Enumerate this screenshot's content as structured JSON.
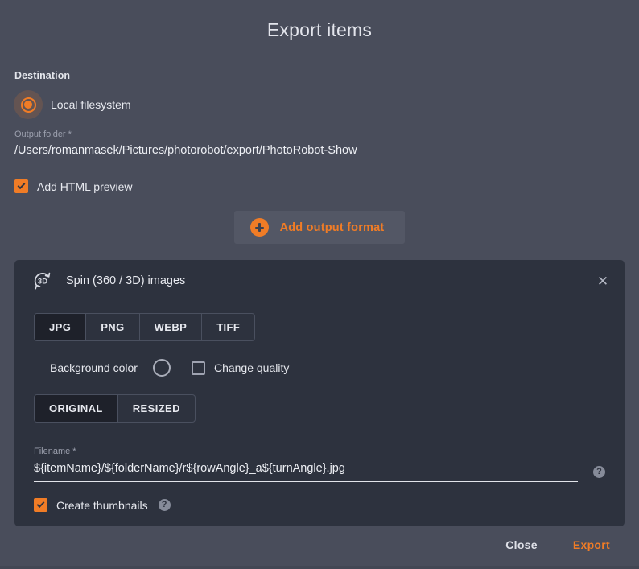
{
  "dialog": {
    "title": "Export items"
  },
  "destination": {
    "section_label": "Destination",
    "radio_label": "Local filesystem",
    "radio_selected": true,
    "output_folder": {
      "label": "Output folder *",
      "value": "/Users/romanmasek/Pictures/photorobot/export/PhotoRobot-Show"
    },
    "html_preview": {
      "label": "Add HTML preview",
      "checked": true
    }
  },
  "add_output_format": {
    "label": "Add output format",
    "icon": "plus-circle-icon"
  },
  "format_card": {
    "icon": "spin-3d-icon",
    "icon_text": "3D",
    "title": "Spin (360 / 3D) images",
    "close_icon": "close-icon",
    "file_type_tabs": [
      {
        "label": "JPG",
        "active": true
      },
      {
        "label": "PNG",
        "active": false
      },
      {
        "label": "WEBP",
        "active": false
      },
      {
        "label": "TIFF",
        "active": false
      }
    ],
    "background_color": {
      "label": "Background color",
      "swatch_icon": "color-swatch-icon"
    },
    "change_quality": {
      "label": "Change quality",
      "checked": false
    },
    "size_tabs": [
      {
        "label": "ORIGINAL",
        "active": true
      },
      {
        "label": "RESIZED",
        "active": false
      }
    ],
    "filename": {
      "label": "Filename *",
      "value": "${itemName}/${folderName}/r${rowAngle}_a${turnAngle}.jpg",
      "help_icon": "help-icon",
      "help_glyph": "?"
    },
    "create_thumbnails": {
      "label": "Create thumbnails",
      "checked": true,
      "help_icon": "help-icon",
      "help_glyph": "?"
    }
  },
  "footer": {
    "close_label": "Close",
    "export_label": "Export"
  },
  "colors": {
    "accent": "#f07c26",
    "background": "#494d5b",
    "card_background": "#2d323e",
    "active_tab": "#1e212a",
    "text": "#e8eaf0",
    "muted_text": "#9ca0ae"
  }
}
